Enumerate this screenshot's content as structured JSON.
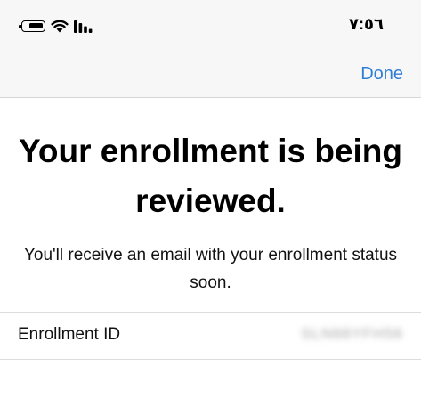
{
  "status_bar": {
    "time": "٧:٥٦",
    "battery_level": 0.8,
    "icons": [
      "battery-icon",
      "wifi-icon",
      "cellular-signal-icon"
    ]
  },
  "nav": {
    "done_label": "Done"
  },
  "main": {
    "title": "Your enrollment is being reviewed.",
    "subtitle": "You'll receive an email with your enrollment status soon."
  },
  "details": {
    "enrollment_id_label": "Enrollment ID",
    "enrollment_id_value": "SLN88YFH56"
  },
  "colors": {
    "accent": "#2f7fd6",
    "bar_background": "#f7f7f7",
    "separator": "#dcdcde"
  }
}
